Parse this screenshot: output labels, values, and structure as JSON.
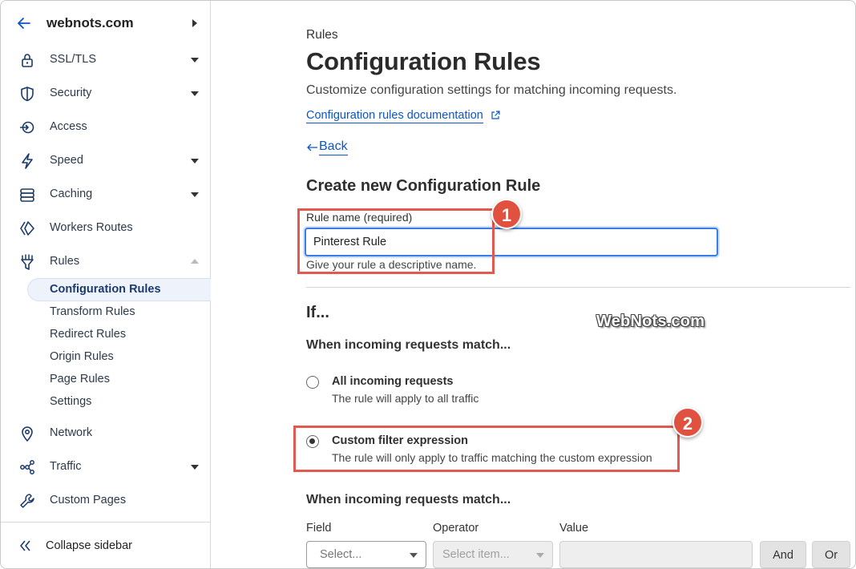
{
  "sidebar": {
    "site_name": "webnots.com",
    "items": [
      {
        "label": "SSL/TLS"
      },
      {
        "label": "Security"
      },
      {
        "label": "Access"
      },
      {
        "label": "Speed"
      },
      {
        "label": "Caching"
      },
      {
        "label": "Workers Routes"
      },
      {
        "label": "Rules"
      },
      {
        "label": "Network"
      },
      {
        "label": "Traffic"
      },
      {
        "label": "Custom Pages"
      }
    ],
    "rules_subitems": [
      {
        "label": "Configuration Rules",
        "active": true
      },
      {
        "label": "Transform Rules"
      },
      {
        "label": "Redirect Rules"
      },
      {
        "label": "Origin Rules"
      },
      {
        "label": "Page Rules"
      },
      {
        "label": "Settings"
      }
    ],
    "collapse_label": "Collapse sidebar"
  },
  "main": {
    "breadcrumb": "Rules",
    "title": "Configuration Rules",
    "description": "Customize configuration settings for matching incoming requests.",
    "doc_link": "Configuration rules documentation",
    "back_link": "Back",
    "form_title": "Create new Configuration Rule",
    "rule_name_label": "Rule name (required)",
    "rule_name_value": "Pinterest Rule",
    "rule_name_helper": "Give your rule a descriptive name.",
    "if_heading": "If...",
    "match_heading": "When incoming requests match...",
    "options": [
      {
        "title": "All incoming requests",
        "subtitle": "The rule will apply to all traffic",
        "selected": false
      },
      {
        "title": "Custom filter expression",
        "subtitle": "The rule will only apply to traffic matching the custom expression",
        "selected": true
      }
    ],
    "expression_heading": "When incoming requests match...",
    "columns": {
      "field": "Field",
      "operator": "Operator",
      "value": "Value"
    },
    "field_placeholder": "Select...",
    "operator_placeholder": "Select item...",
    "and_button": "And",
    "or_button": "Or"
  },
  "annotations": {
    "badge_1": "1",
    "badge_2": "2",
    "watermark": "WebNots.com"
  },
  "colors": {
    "link": "#0b55c6",
    "callout": "#e25a4f",
    "focus": "#3a7de6"
  }
}
